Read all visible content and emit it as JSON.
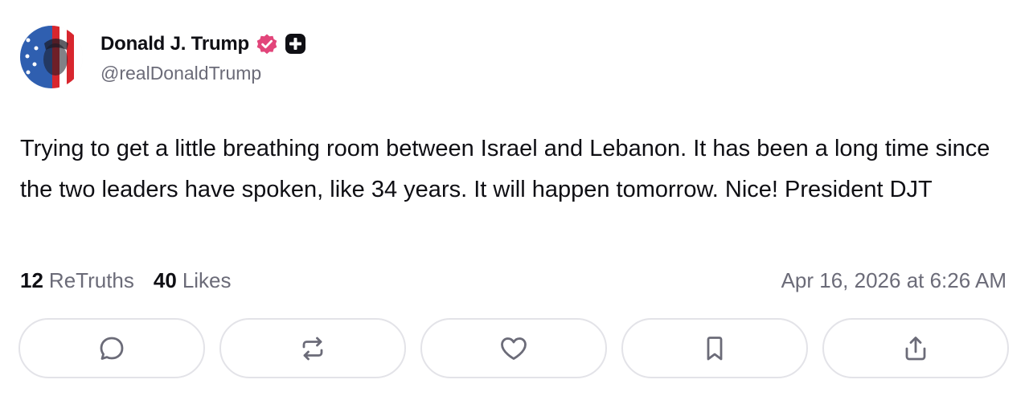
{
  "author": {
    "display_name": "Donald J. Trump",
    "handle": "@realDonaldTrump",
    "verified_badge_color": "#e2457a",
    "avatar_icon": "flag-portrait-avatar",
    "badges": [
      "verified-badge-icon",
      "plus-badge-icon"
    ]
  },
  "post": {
    "text": "Trying to get a little breathing room between Israel and Lebanon. It has been a long time since the two leaders have spoken, like 34 years. It will happen tomorrow. Nice! President DJT"
  },
  "stats": {
    "retruths_count": "12",
    "retruths_label": "ReTruths",
    "likes_count": "40",
    "likes_label": "Likes",
    "timestamp": "Apr 16, 2026 at 6:26 AM"
  },
  "actions": [
    {
      "name": "reply",
      "icon": "comment-icon"
    },
    {
      "name": "retruth",
      "icon": "repost-icon"
    },
    {
      "name": "like",
      "icon": "heart-icon"
    },
    {
      "name": "bookmark",
      "icon": "bookmark-icon"
    },
    {
      "name": "share",
      "icon": "share-icon"
    }
  ],
  "colors": {
    "text_primary": "#0f0f14",
    "text_secondary": "#6b6b78",
    "button_border": "#e3e3e8"
  }
}
